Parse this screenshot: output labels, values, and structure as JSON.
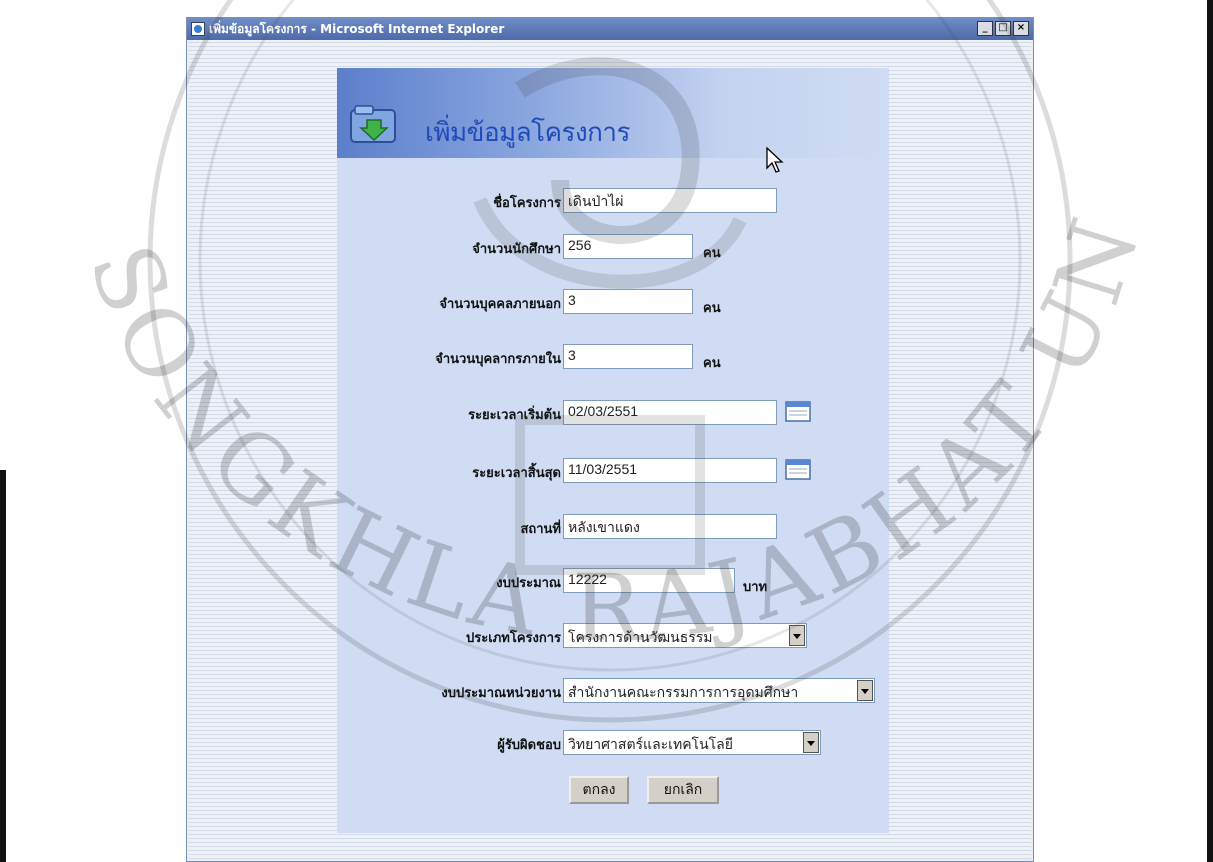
{
  "window": {
    "title": "เพิ่มข้อมูลโครงการ - Microsoft Internet Explorer",
    "minimize": "_",
    "maximize": "□",
    "close": "×"
  },
  "page": {
    "banner_title": "เพิ่มข้อมูลโครงการ"
  },
  "form": {
    "project_name": {
      "label": "ชื่อโครงการ",
      "value": "เดินป่าไผ่"
    },
    "students": {
      "label": "จำนวนนักศึกษา",
      "value": "256",
      "unit": "คน"
    },
    "external_people": {
      "label": "จำนวนบุคคลภายนอก",
      "value": "3",
      "unit": "คน"
    },
    "internal_staff": {
      "label": "จำนวนบุคลากรภายใน",
      "value": "3",
      "unit": "คน"
    },
    "start_date": {
      "label": "ระยะเวลาเริ่มต้น",
      "value": "02/03/2551",
      "icon": "calendar-icon"
    },
    "end_date": {
      "label": "ระยะเวลาสิ้นสุด",
      "value": "11/03/2551",
      "icon": "calendar-icon"
    },
    "location": {
      "label": "สถานที่",
      "value": "หลังเขาแดง"
    },
    "budget": {
      "label": "งบประมาณ",
      "value": "12222",
      "unit": "บาท"
    },
    "project_type": {
      "label": "ประเภทโครงการ",
      "selected": "โครงการด้านวัฒนธรรม"
    },
    "unit_budget": {
      "label": "งบประมาณหน่วยงาน",
      "selected": "สำนักงานคณะกรรมการการอุดมศึกษา"
    },
    "responsible": {
      "label": "ผู้รับผิดชอบ",
      "selected": "วิทยาศาสตร์และเทคโนโลยี"
    }
  },
  "buttons": {
    "ok": "ตกลง",
    "cancel": "ยกเลิก"
  },
  "watermark": {
    "text": "SONGKHLA RAJABHAT UNIVERSITY"
  },
  "colors": {
    "title_bar": "#5a76b6",
    "panel": "#cfdcf3",
    "banner_text": "#1f4ab8"
  }
}
